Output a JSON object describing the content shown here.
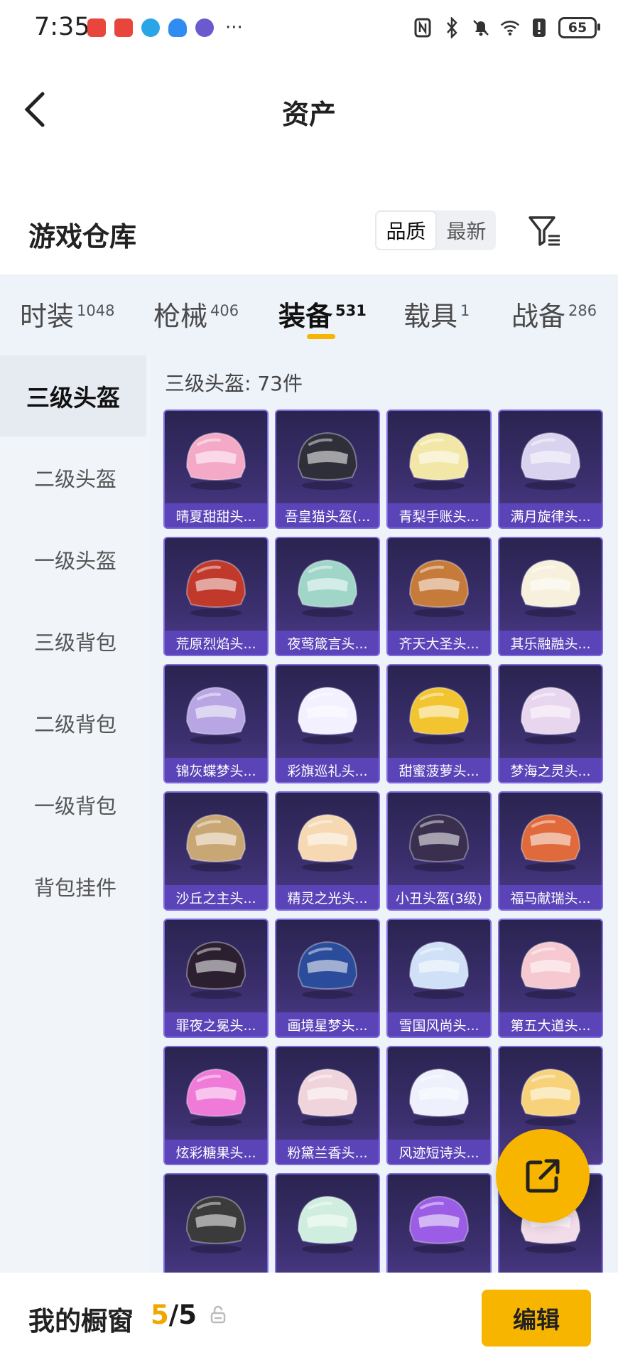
{
  "status_bar": {
    "time": "7:35",
    "battery": "65"
  },
  "nav": {
    "title": "资产"
  },
  "section": {
    "title": "游戏仓库",
    "sort_options": [
      "品质",
      "最新"
    ],
    "active_sort": "品质"
  },
  "tabs": [
    {
      "label": "时装",
      "count": "1048",
      "active": false
    },
    {
      "label": "枪械",
      "count": "406",
      "active": false
    },
    {
      "label": "装备",
      "count": "531",
      "active": true
    },
    {
      "label": "载具",
      "count": "1",
      "active": false
    },
    {
      "label": "战备",
      "count": "286",
      "active": false
    }
  ],
  "sidebar": [
    {
      "label": "三级头盔",
      "active": true
    },
    {
      "label": "二级头盔",
      "active": false
    },
    {
      "label": "一级头盔",
      "active": false
    },
    {
      "label": "三级背包",
      "active": false
    },
    {
      "label": "二级背包",
      "active": false
    },
    {
      "label": "一级背包",
      "active": false
    },
    {
      "label": "背包挂件",
      "active": false
    }
  ],
  "grid": {
    "title": "三级头盔: 73件",
    "items": [
      {
        "name": "晴夏甜甜头...",
        "color": "#f4a9c7"
      },
      {
        "name": "吾皇猫头盔(...",
        "color": "#2f2f3a"
      },
      {
        "name": "青梨手账头...",
        "color": "#f2e7a6"
      },
      {
        "name": "满月旋律头...",
        "color": "#d9d3ef"
      },
      {
        "name": "荒原烈焰头...",
        "color": "#c0392b"
      },
      {
        "name": "夜莺箴言头...",
        "color": "#9fd6c8"
      },
      {
        "name": "齐天大圣头...",
        "color": "#c77b3a"
      },
      {
        "name": "其乐融融头...",
        "color": "#f6f0dc"
      },
      {
        "name": "锦灰蝶梦头...",
        "color": "#b7a6e3"
      },
      {
        "name": "彩旗巡礼头...",
        "color": "#f3f0ff"
      },
      {
        "name": "甜蜜菠萝头...",
        "color": "#f2c530"
      },
      {
        "name": "梦海之灵头...",
        "color": "#e8d6ef"
      },
      {
        "name": "沙丘之主头...",
        "color": "#c9a774"
      },
      {
        "name": "精灵之光头...",
        "color": "#f6d8b2"
      },
      {
        "name": "小丑头盔(3级)",
        "color": "#3a2f4e"
      },
      {
        "name": "福马献瑞头...",
        "color": "#e06a3b"
      },
      {
        "name": "罪夜之冕头...",
        "color": "#2b1f30"
      },
      {
        "name": "画境星梦头...",
        "color": "#2a4c9a"
      },
      {
        "name": "雪国风尚头...",
        "color": "#cfe0f7"
      },
      {
        "name": "第五大道头...",
        "color": "#f5c9cf"
      },
      {
        "name": "炫彩糖果头...",
        "color": "#ef7ad8"
      },
      {
        "name": "粉黛兰香头...",
        "color": "#f0d4dc"
      },
      {
        "name": "风迹短诗头...",
        "color": "#eef0fb"
      },
      {
        "name": "",
        "color": "#f7d27a"
      },
      {
        "name": "",
        "color": "#3b3b3b"
      },
      {
        "name": "",
        "color": "#cfeee0"
      },
      {
        "name": "",
        "color": "#9b5de5"
      },
      {
        "name": "",
        "color": "#f2dcea"
      }
    ]
  },
  "showcase": {
    "label": "我的橱窗",
    "current": "5",
    "total": "/5"
  },
  "edit_button": "编辑",
  "colors": {
    "accent": "#f7b500",
    "card_label": "#5a44b8",
    "background": "#eef2f9"
  }
}
